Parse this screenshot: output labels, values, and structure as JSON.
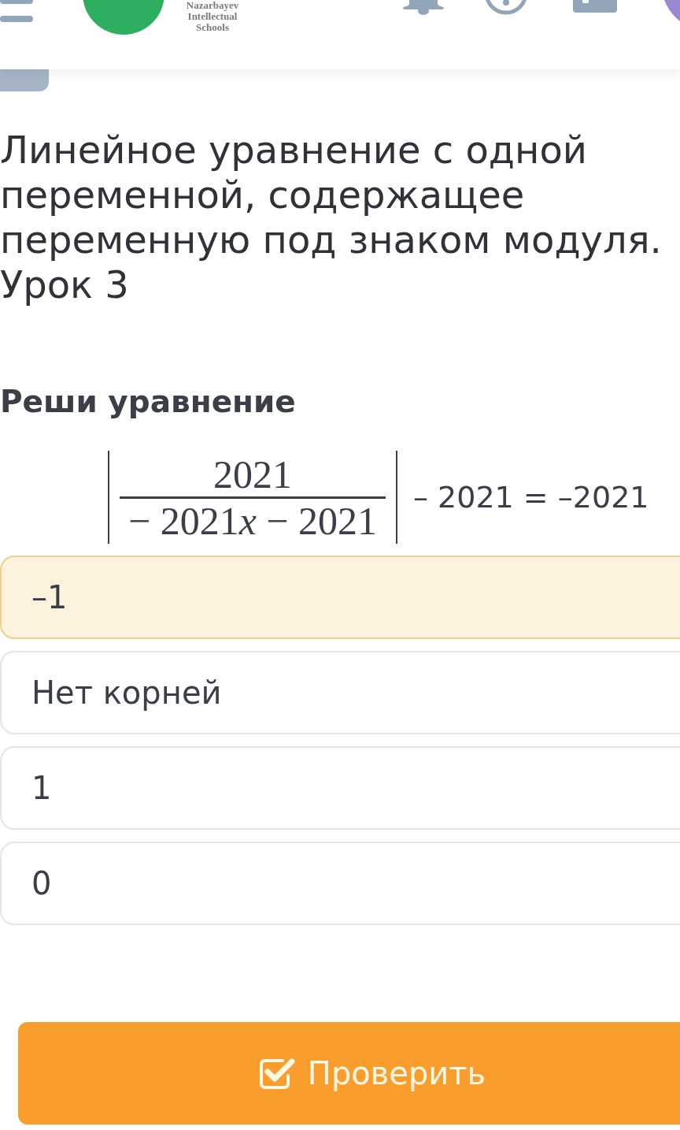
{
  "header": {
    "logo_lines": [
      "Nazarbayev",
      "Intellectual",
      "Schools"
    ]
  },
  "lesson_title": "Линейное уравнение с одной переменной, содержащее переменную под знаком модуля. Урок 3",
  "task": {
    "prompt": "Реши уравнение",
    "equation": {
      "numerator": "2021",
      "denominator": [
        {
          "text": "− 2021",
          "kind": "number"
        },
        {
          "text": "x",
          "kind": "variable"
        },
        {
          "text": "− 2021",
          "kind": "number"
        }
      ],
      "right_side": "– 2021 = –2021"
    }
  },
  "options": [
    {
      "label": "–1",
      "selected": true
    },
    {
      "label": "Нет корней",
      "selected": false
    },
    {
      "label": "1",
      "selected": false
    },
    {
      "label": "0",
      "selected": false
    }
  ],
  "check_button": {
    "label": "Проверить"
  }
}
